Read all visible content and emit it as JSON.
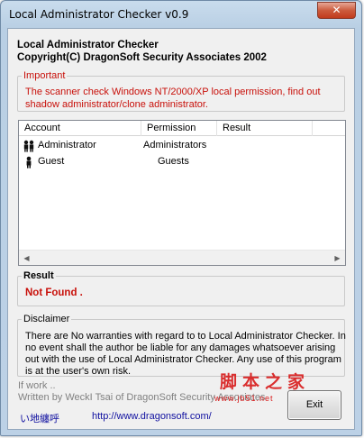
{
  "window": {
    "title": "Local Administrator Checker v0.9",
    "close_glyph": "✕"
  },
  "header": {
    "app_name": "Local Administrator Checker",
    "copyright": "Copyright(C) DragonSoft Security Associates 2002"
  },
  "important": {
    "label": "Important",
    "text": "The scanner check Windows NT/2000/XP local permission, find out shadow administrator/clone administrator."
  },
  "table": {
    "columns": [
      "Account",
      "Permission",
      "Result"
    ],
    "rows": [
      {
        "icon": "user-group-icon",
        "account": "Administrator",
        "permission": "Administrators",
        "result": ""
      },
      {
        "icon": "user-icon",
        "account": "Guest",
        "permission": "Guests",
        "result": ""
      }
    ]
  },
  "result": {
    "label": "Result",
    "value": "Not Found ."
  },
  "disclaimer": {
    "label": "Disclaimer",
    "text": "There are No warranties with regard to to Local Administrator Checker. In no event shall the author be liable for any damages whatsoever arising out with the use of Local Administrator Checker. Any use of this program is at the user's own risk."
  },
  "footer": {
    "status": "If work ..",
    "written_by": "Written by WeckI Tsai of DragonSoft Security Associates",
    "chinese_text": "い地纏呼",
    "url": "http://www.dragonsoft.com/"
  },
  "buttons": {
    "exit": "Exit"
  },
  "watermark": {
    "text": "脚本之家",
    "url": "www.jb51.net"
  },
  "colors": {
    "accent_red": "#c8100a",
    "link_blue": "#1010a0"
  }
}
